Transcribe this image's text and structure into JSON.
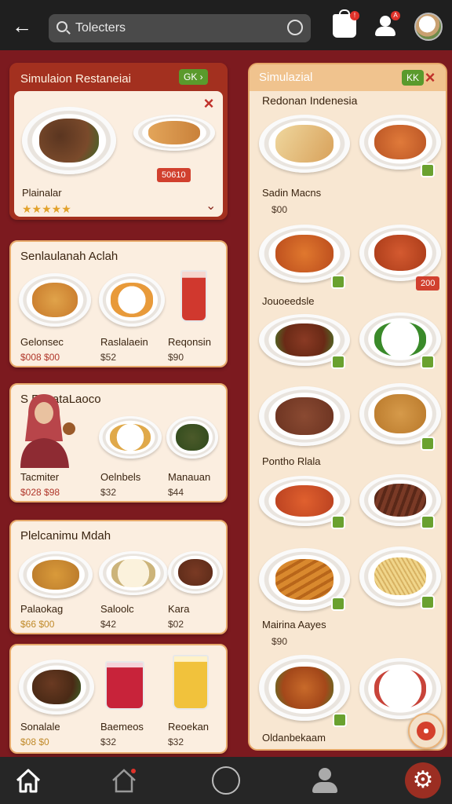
{
  "topbar": {
    "search_text": "Tolecters",
    "icons": [
      "back-arrow-icon",
      "search-icon",
      "mic-icon",
      "shopping-bag-icon",
      "user-icon",
      "avatar"
    ],
    "bag_badge": "!",
    "user_badge": "A"
  },
  "left": {
    "card1": {
      "title": "Simulaion Restaneiai",
      "chip": "GK",
      "tag": "50610",
      "label": "Plainalar",
      "rating": "★★★★★"
    },
    "card2": {
      "title": "Senlaulanah Aclah",
      "items": [
        {
          "label": "Gelonsec",
          "price": "$008 $00"
        },
        {
          "label": "Raslalaein",
          "price": "$52"
        },
        {
          "label": "Reqonsin",
          "price": "$90"
        }
      ]
    },
    "card3": {
      "title": "S RosataLaoco",
      "items": [
        {
          "label": "Tacmiter",
          "price": "$028 $98"
        },
        {
          "label": "Oelnbels",
          "price": "$32"
        },
        {
          "label": "Manauan",
          "price": "$44"
        }
      ]
    },
    "card4": {
      "title": "Plelcanimu Mdah",
      "items": [
        {
          "label": "Palaokag",
          "price": "$66 $00"
        },
        {
          "label": "Saloolc",
          "price": "$42"
        },
        {
          "label": "Kara",
          "price": "$02"
        }
      ]
    },
    "card5": {
      "items": [
        {
          "label": "Sonalale",
          "price": "$08 $0"
        },
        {
          "label": "Baemeos",
          "price": "$32"
        },
        {
          "label": "Reoekan",
          "price": "$32"
        }
      ]
    }
  },
  "right": {
    "header": "Simulazial",
    "chip": "KK",
    "section": "Redonan Indenesia",
    "labels": [
      {
        "label": "Sadin Macns",
        "price": "$00"
      },
      {
        "label": "Jouoeedsle",
        "price": ""
      },
      {
        "label": "Pontho Rlala",
        "price": ""
      },
      {
        "label": "Mairina Aayes",
        "price": "$90"
      },
      {
        "label": "Oldanbekaam",
        "price": ""
      }
    ],
    "tag": "200"
  },
  "nav": {
    "items": [
      "home-icon",
      "house-outline-icon",
      "circle-icon",
      "profile-icon",
      "settings-icon"
    ]
  },
  "colors": {
    "bg": "#7c1a1f",
    "panel": "#fbeee0",
    "accent": "#5a9a2c",
    "red": "#d1402e"
  }
}
